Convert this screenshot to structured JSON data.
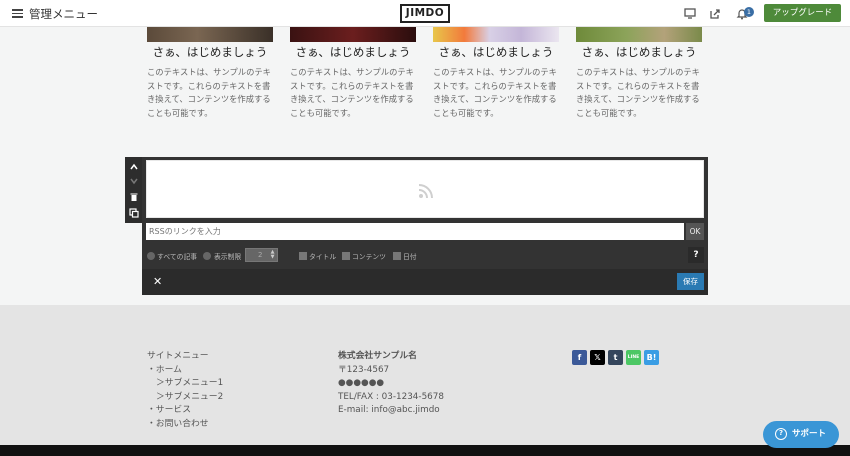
{
  "topbar": {
    "admin_menu_label": "管理メニュー",
    "logo_text": "JIMDO",
    "notification_count": "1",
    "upgrade_label": "アップグレード",
    "icons": [
      "hamburger-icon",
      "monitor-icon",
      "external-link-icon",
      "bell-icon"
    ]
  },
  "cards": [
    {
      "title": "さぁ、はじめましょう",
      "text": "このテキストは、サンプルのテキストです。これらのテキストを書き換えて、コンテンツを作成することも可能です。"
    },
    {
      "title": "さぁ、はじめましょう",
      "text": "このテキストは、サンプルのテキストです。これらのテキストを書き換えて、コンテンツを作成することも可能です。"
    },
    {
      "title": "さぁ、はじめましょう",
      "text": "このテキストは、サンプルのテキストです。これらのテキストを書き換えて、コンテンツを作成することも可能です。"
    },
    {
      "title": "さぁ、はじめましょう",
      "text": "このテキストは、サンプルのテキストです。これらのテキストを書き換えて、コンテンツを作成することも可能です。"
    }
  ],
  "rss_editor": {
    "input_placeholder": "RSSのリンクを入力",
    "ok_label": "OK",
    "option_all": "すべての記事",
    "option_limit": "表示制限",
    "limit_value": "2",
    "check_title": "タイトル",
    "check_content": "コンテンツ",
    "check_date": "日付",
    "help_label": "?",
    "close_label": "✕",
    "save_label": "保存"
  },
  "footer": {
    "site_menu": [
      "サイトメニュー",
      "・ホーム",
      "＞サブメニュー1",
      "＞サブメニュー2",
      "・サービス",
      "・お問い合わせ"
    ],
    "company": {
      "name": "株式会社サンプル名",
      "postal": "〒123-4567",
      "address": "●●●●●●",
      "tel": "TEL/FAX : 03-1234-5678",
      "email": "E-mail: info@abc.jimdo"
    },
    "social": [
      {
        "name": "facebook",
        "glyph": "f",
        "color": "#3b5998"
      },
      {
        "name": "x",
        "glyph": "𝕏",
        "color": "#000000"
      },
      {
        "name": "tumblr",
        "glyph": "t",
        "color": "#35465c"
      },
      {
        "name": "line",
        "glyph": "LINE",
        "color": "#4cc764"
      },
      {
        "name": "hatena",
        "glyph": "B!",
        "color": "#3a9de4"
      }
    ]
  },
  "support": {
    "label": "サポート"
  }
}
